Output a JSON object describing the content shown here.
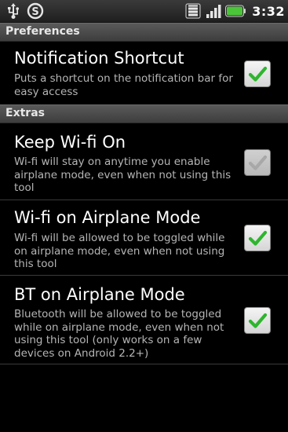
{
  "status_bar": {
    "time": "3:32",
    "icons": [
      "usb-icon",
      "skype-icon",
      "wifi-icon",
      "signal-icon",
      "battery-icon"
    ]
  },
  "categories": [
    {
      "label": "Preferences"
    },
    {
      "label": "Extras"
    }
  ],
  "preferences": [
    {
      "title": "Notification Shortcut",
      "summary": "Puts a shortcut on the notification bar for easy access",
      "checked": true,
      "enabled": true
    },
    {
      "title": "Keep Wi-fi On",
      "summary": "Wi-fi will stay on anytime you enable airplane mode, even when not using this tool",
      "checked": true,
      "enabled": false
    },
    {
      "title": "Wi-fi on Airplane Mode",
      "summary": "Wi-fi will be allowed to be toggled while on airplane mode, even when not using this tool",
      "checked": true,
      "enabled": true
    },
    {
      "title": "BT on Airplane Mode",
      "summary": "Bluetooth will be allowed to be toggled while on airplane mode, even when not using this tool (only works on a few devices on Android 2.2+)",
      "checked": true,
      "enabled": true
    }
  ],
  "colors": {
    "check_green": "#2fb52f",
    "check_disabled": "#b0b0b0",
    "battery_green": "#4cc43a"
  }
}
